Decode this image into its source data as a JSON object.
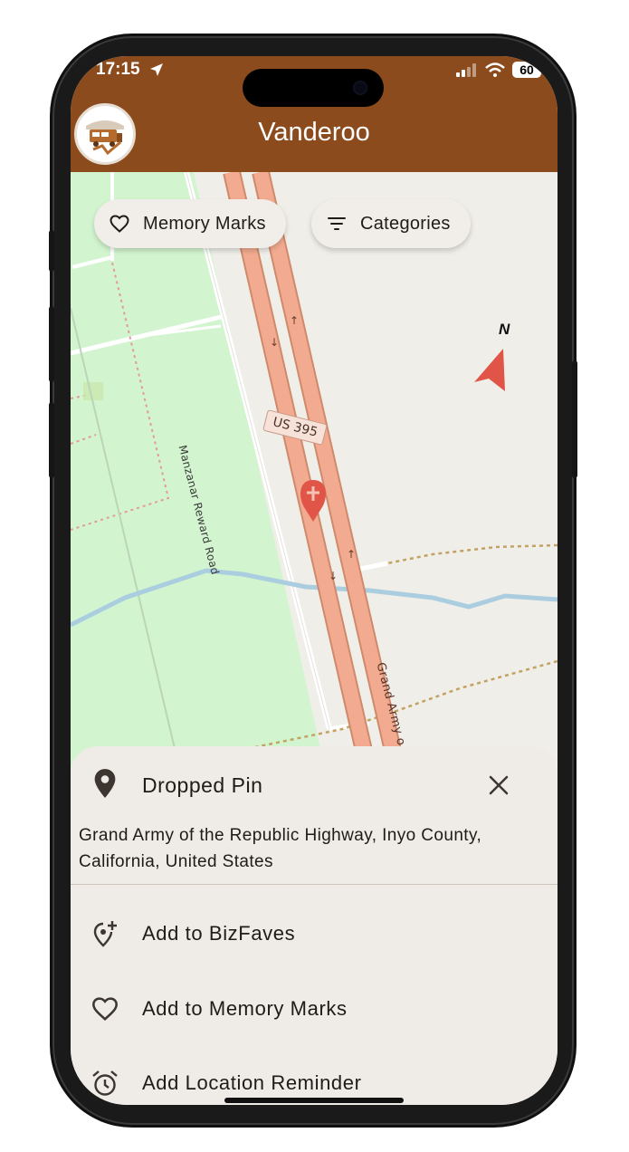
{
  "status_bar": {
    "time": "17:15",
    "battery": "60"
  },
  "header": {
    "title": "Vanderoo",
    "logo_icon": "van-logo-icon",
    "color": "#8c4b1d"
  },
  "map": {
    "chips": [
      {
        "label": "Memory Marks",
        "icon": "heart-icon"
      },
      {
        "label": "Categories",
        "icon": "filter-icon"
      }
    ],
    "compass_label": "N",
    "road_labels": {
      "highway_shield": "US 395",
      "side_road": "Manzanar Reward Road",
      "highway_name": "Grand Army o"
    }
  },
  "sheet": {
    "title": "Dropped Pin",
    "address": "Grand Army of the Republic Highway, Inyo County, California, United States",
    "actions": [
      {
        "label": "Add to BizFaves",
        "icon": "add-location-icon"
      },
      {
        "label": "Add to Memory Marks",
        "icon": "heart-icon"
      },
      {
        "label": "Add Location Reminder",
        "icon": "alarm-icon"
      }
    ]
  }
}
